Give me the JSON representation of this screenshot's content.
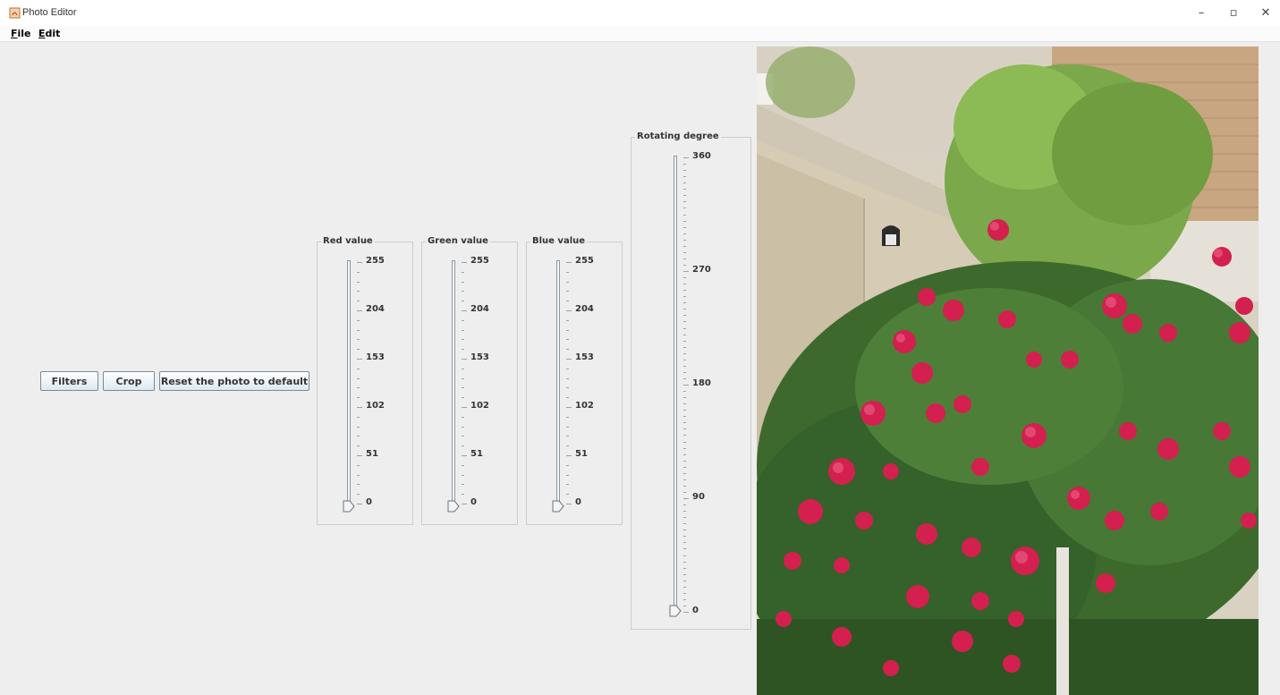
{
  "window": {
    "title": "Photo Editor",
    "minimize_label": "–",
    "maximize_label": "▫",
    "close_label": "✕"
  },
  "menu": {
    "file": {
      "mnemonic": "F",
      "rest": "ile"
    },
    "edit": {
      "mnemonic": "E",
      "rest": "dit"
    }
  },
  "toolbar": {
    "filters_label": "Filters",
    "crop_label": "Crop",
    "reset_label": "Reset the photo to default"
  },
  "sliders": {
    "red": {
      "title": "Red value",
      "labels": [
        "255",
        "204",
        "153",
        "102",
        "51",
        "0"
      ],
      "value": 0
    },
    "green": {
      "title": "Green value",
      "labels": [
        "255",
        "204",
        "153",
        "102",
        "51",
        "0"
      ],
      "value": 0
    },
    "blue": {
      "title": "Blue value",
      "labels": [
        "255",
        "204",
        "153",
        "102",
        "51",
        "0"
      ],
      "value": 0
    },
    "rotation": {
      "title": "Rotating degree",
      "labels": [
        "360",
        "270",
        "180",
        "90",
        "0"
      ],
      "value": 0
    }
  },
  "photo": {
    "description_icon": "rose-garden-photo"
  }
}
